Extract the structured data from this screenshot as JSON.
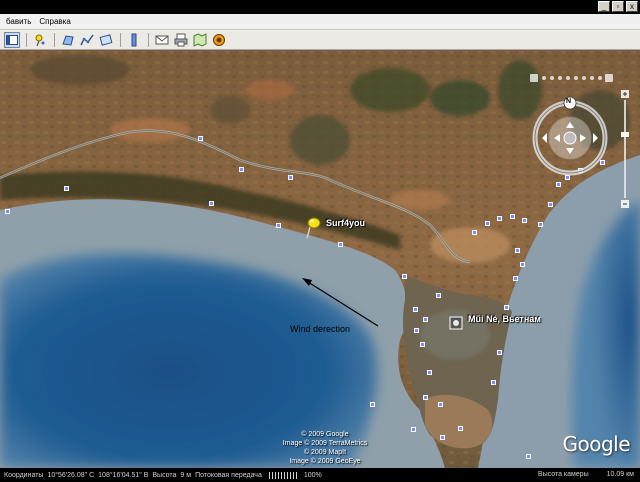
{
  "window": {
    "controls": [
      "_",
      "▫",
      "x"
    ]
  },
  "menu": {
    "items": [
      "бавить",
      "Справка"
    ]
  },
  "toolbar": {
    "icons": [
      "sidebar-toggle-icon",
      "placemark-icon",
      "polygon-icon",
      "path-icon",
      "overlay-icon",
      "ruler-icon",
      "email-icon",
      "print-icon",
      "maps-icon",
      "sky-icon"
    ]
  },
  "map": {
    "placemark_label": "Surf4you",
    "town_label": "Mũi Né, Вьетнам",
    "annotation": "Wind derection",
    "copyright": [
      "© 2009 Google",
      "Image © 2009 TerraMetrics",
      "© 2009 MapIt",
      "Image © 2009 GeoEye"
    ],
    "logo": "Google",
    "nav_north": "N",
    "colors": {
      "land": "#8a6a48",
      "shallow_water": "#8a9aa6",
      "deep_water": "#1e5a8a",
      "poi": "#7b8cff",
      "pin": "#f5e01a"
    }
  },
  "status": {
    "coords_label": "Координаты",
    "lat": "10°56'26.08\" С",
    "lon": "108°16'04.51\" В",
    "alt_label": "Высота",
    "alt_value": "9 м",
    "stream_label": "Потоковая передача",
    "stream_percent": "100%",
    "cam_label": "Высота камеры",
    "cam_value": "10.09 км"
  }
}
